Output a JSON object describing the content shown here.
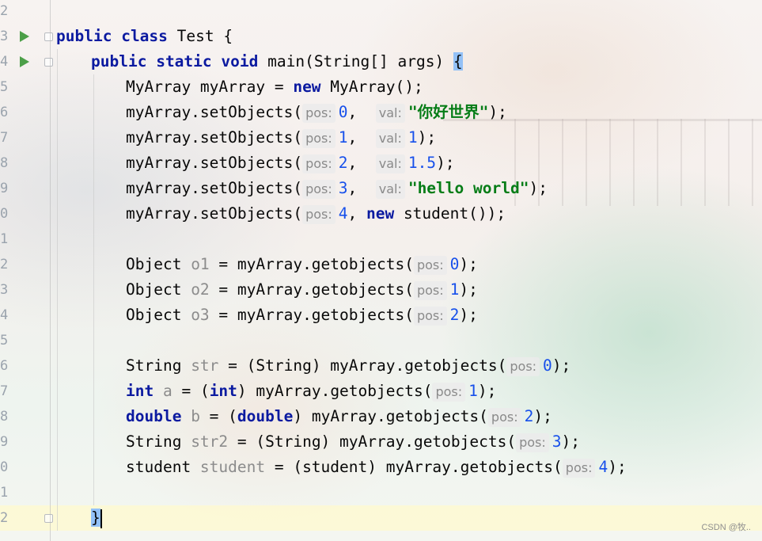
{
  "gutter": {
    "line_numbers": [
      "2",
      "3",
      "4",
      "5",
      "6",
      "7",
      "8",
      "9",
      "0",
      "1",
      "2",
      "3",
      "4",
      "5",
      "6",
      "7",
      "8",
      "9",
      "0",
      "1",
      "2"
    ]
  },
  "code": {
    "l3": {
      "k1": "public",
      "k2": "class",
      "rest": " Test {"
    },
    "l4": {
      "k1": "public",
      "k2": "static",
      "k3": "void",
      "rest": " main(String[] args) ",
      "brace": "{"
    },
    "l5": {
      "a": "MyArray myArray = ",
      "kw": "new",
      "b": " MyArray();"
    },
    "l6": {
      "call": "myArray.setObjects(",
      "h1": "pos:",
      "n1": "0",
      ",": ",",
      "h2": "val:",
      "s": "\"你好世界\"",
      "end": ");"
    },
    "l7": {
      "call": "myArray.setObjects(",
      "h1": "pos:",
      "n1": "1",
      "sep": ",",
      "h2": "val:",
      "n2": "1",
      "end": ");"
    },
    "l8": {
      "call": "myArray.setObjects(",
      "h1": "pos:",
      "n1": "2",
      "sep": ",",
      "h2": "val:",
      "n2": "1.5",
      "end": ");"
    },
    "l9": {
      "call": "myArray.setObjects(",
      "h1": "pos:",
      "n1": "3",
      "sep": ",",
      "h2": "val:",
      "s": "\"hello world\"",
      "end": ");"
    },
    "l10": {
      "call": "myArray.setObjects(",
      "h1": "pos:",
      "n1": "4",
      "sep": ", ",
      "kw": "new",
      "end": " student());"
    },
    "l12": {
      "a": "Object ",
      "v": "o1",
      "b": " = myArray.getobjects(",
      "h": "pos:",
      "n": "0",
      "end": ");"
    },
    "l13": {
      "a": "Object ",
      "v": "o2",
      "b": " = myArray.getobjects(",
      "h": "pos:",
      "n": "1",
      "end": ");"
    },
    "l14": {
      "a": "Object ",
      "v": "o3",
      "b": " = myArray.getobjects(",
      "h": "pos:",
      "n": "2",
      "end": ");"
    },
    "l16": {
      "a": "String ",
      "v": "str",
      "b": " = (String) myArray.getobjects(",
      "h": "pos:",
      "n": "0",
      "end": ");"
    },
    "l17": {
      "kw": "int",
      "v": " a",
      "b": " = (",
      "kw2": "int",
      "c": ") myArray.getobjects(",
      "h": "pos:",
      "n": "1",
      "end": ");"
    },
    "l18": {
      "kw": "double",
      "v": " b",
      "b": " = (",
      "kw2": "double",
      "c": ") myArray.getobjects(",
      "h": "pos:",
      "n": "2",
      "end": ");"
    },
    "l19": {
      "a": "String ",
      "v": "str2",
      "b": " = (String) myArray.getobjects(",
      "h": "pos:",
      "n": "3",
      "end": ");"
    },
    "l20": {
      "a": "student ",
      "v": "student",
      "b": " = (student) myArray.getobjects(",
      "h": "pos:",
      "n": "4",
      "end": ");"
    },
    "l22": {
      "brace": "}"
    }
  },
  "watermark": "CSDN @牧.."
}
